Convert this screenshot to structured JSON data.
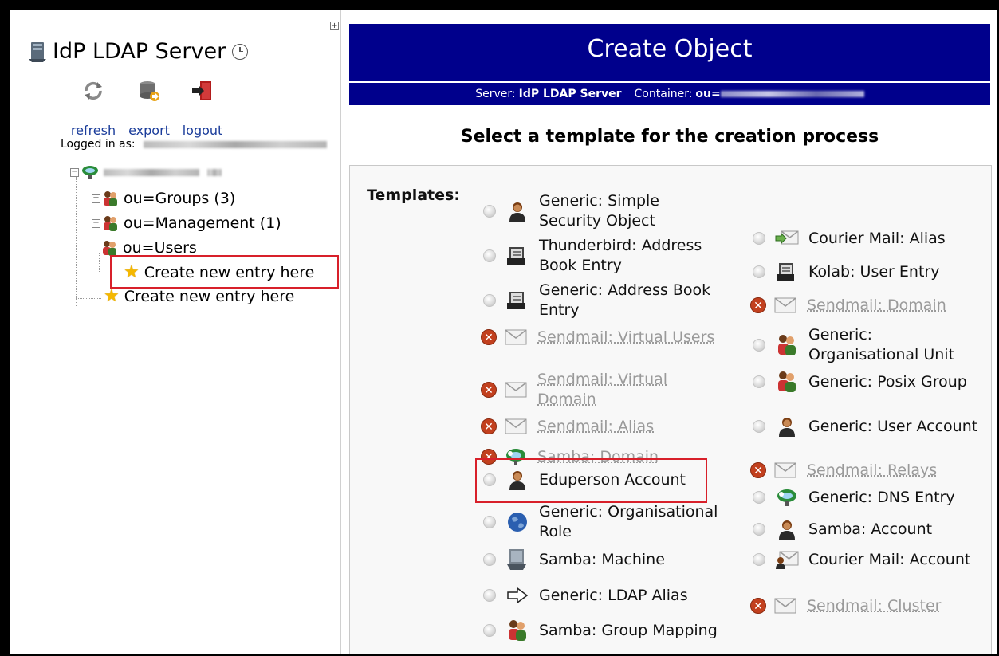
{
  "left": {
    "server_name": "IdP LDAP Server",
    "tools": [
      {
        "label": "refresh",
        "icon": "refresh-icon"
      },
      {
        "label": "export",
        "icon": "export-icon"
      },
      {
        "label": "logout",
        "icon": "logout-icon"
      }
    ],
    "logged_in_label": "Logged in as:",
    "tree": {
      "groups": "ou=Groups (3)",
      "management": "ou=Management (1)",
      "users": "ou=Users",
      "create_inner": "Create new entry here",
      "create_outer": "Create new entry here"
    }
  },
  "header": {
    "title": "Create Object",
    "server_label": "Server:",
    "server_value": "IdP LDAP Server",
    "container_label": "Container:",
    "container_value": "ou="
  },
  "heading": "Select a template for the creation process",
  "templates_label": "Templates:",
  "templates_left": [
    {
      "name": "Generic: Simple Security Object",
      "enabled": true,
      "icon": "user-icon"
    },
    {
      "name": "Thunderbird: Address Book Entry",
      "enabled": true,
      "icon": "address-book-icon"
    },
    {
      "name": "Generic: Address Book Entry",
      "enabled": true,
      "icon": "address-book-icon"
    },
    {
      "name": "Sendmail: Virtual Users",
      "enabled": false,
      "icon": "mail-icon"
    },
    {
      "name": "Sendmail: Virtual Domain",
      "enabled": false,
      "icon": "mail-icon"
    },
    {
      "name": "Sendmail: Alias",
      "enabled": false,
      "icon": "mail-icon"
    },
    {
      "name": "Samba: Domain",
      "enabled": false,
      "icon": "network-icon"
    },
    {
      "name": "Eduperson Account",
      "enabled": true,
      "icon": "user-icon"
    },
    {
      "name": "Generic: Organisational Role",
      "enabled": true,
      "icon": "globe-icon"
    },
    {
      "name": "Samba: Machine",
      "enabled": true,
      "icon": "computer-icon"
    },
    {
      "name": "Generic: LDAP Alias",
      "enabled": true,
      "icon": "arrow-icon"
    },
    {
      "name": "Samba: Group Mapping",
      "enabled": true,
      "icon": "group-icon"
    }
  ],
  "templates_right": [
    {
      "name": "Courier Mail: Alias",
      "enabled": true,
      "icon": "mail-alias-icon"
    },
    {
      "name": "Kolab: User Entry",
      "enabled": true,
      "icon": "address-book-icon"
    },
    {
      "name": "Sendmail: Domain",
      "enabled": false,
      "icon": "mail-icon"
    },
    {
      "name": "Generic: Organisational Unit",
      "enabled": true,
      "icon": "group-icon"
    },
    {
      "name": "Generic: Posix Group",
      "enabled": true,
      "icon": "group-icon"
    },
    {
      "name": "Generic: User Account",
      "enabled": true,
      "icon": "user-icon"
    },
    {
      "name": "Sendmail: Relays",
      "enabled": false,
      "icon": "mail-icon"
    },
    {
      "name": "Generic: DNS Entry",
      "enabled": true,
      "icon": "network-icon"
    },
    {
      "name": "Samba: Account",
      "enabled": true,
      "icon": "user-icon"
    },
    {
      "name": "Courier Mail: Account",
      "enabled": true,
      "icon": "mail-account-icon"
    },
    {
      "name": "Sendmail: Cluster",
      "enabled": false,
      "icon": "mail-icon"
    }
  ],
  "colors": {
    "header_bg": "#00008c",
    "highlight": "#d8202a",
    "link": "#1a3c9a",
    "disabled_text": "#9a9a9a"
  }
}
